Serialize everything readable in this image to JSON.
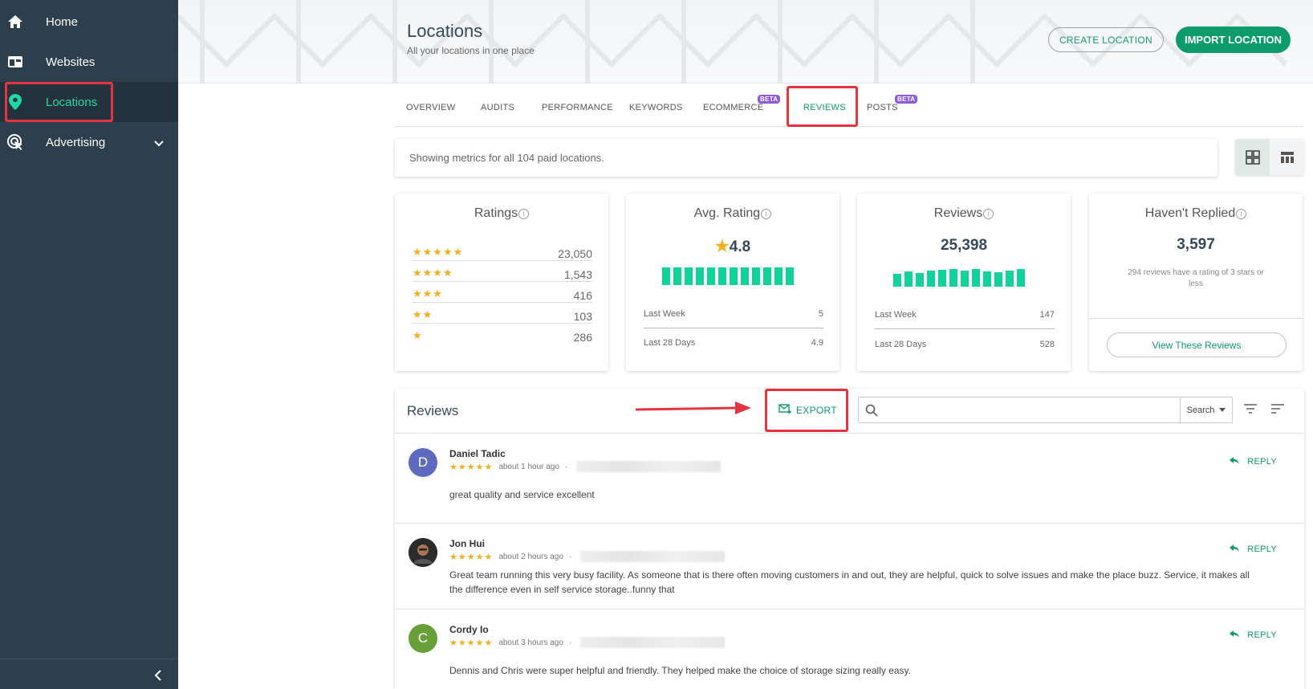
{
  "sidebar": {
    "items": [
      {
        "label": "Home",
        "icon": "home-icon"
      },
      {
        "label": "Websites",
        "icon": "browser-icon"
      },
      {
        "label": "Locations",
        "icon": "map-pin-icon"
      },
      {
        "label": "Advertising",
        "icon": "target-cursor-icon"
      }
    ],
    "active": "Locations"
  },
  "header": {
    "title": "Locations",
    "subtitle": "All your locations in one place",
    "create_label": "CREATE LOCATION",
    "import_label": "IMPORT LOCATION"
  },
  "tabs": [
    {
      "label": "OVERVIEW"
    },
    {
      "label": "AUDITS"
    },
    {
      "label": "PERFORMANCE"
    },
    {
      "label": "KEYWORDS"
    },
    {
      "label": "ECOMMERCE",
      "badge": "BETA"
    },
    {
      "label": "REVIEWS",
      "active": true
    },
    {
      "label": "POSTS",
      "badge": "BETA"
    }
  ],
  "metrics": {
    "text": "Showing metrics for all 104 paid locations."
  },
  "cards": {
    "ratings": {
      "title": "Ratings",
      "rows": [
        {
          "stars": "★★★★★",
          "count": "23,050"
        },
        {
          "stars": "★★★★",
          "count": "1,543"
        },
        {
          "stars": "★★★",
          "count": "416"
        },
        {
          "stars": "★★",
          "count": "103"
        },
        {
          "stars": "★",
          "count": "286"
        }
      ]
    },
    "avg_rating": {
      "title": "Avg. Rating",
      "value": "4.8",
      "star": "★",
      "last_week_label": "Last Week",
      "last_week_value": "5",
      "last_28_label": "Last 28 Days",
      "last_28_value": "4.9"
    },
    "reviews": {
      "title": "Reviews",
      "value": "25,398",
      "last_week_label": "Last Week",
      "last_week_value": "147",
      "last_28_label": "Last 28 Days",
      "last_28_value": "528"
    },
    "not_replied": {
      "title": "Haven't Replied",
      "value": "3,597",
      "note": "294 reviews have a rating of 3 stars or less",
      "button_label": "View These Reviews"
    }
  },
  "reviews_panel": {
    "title": "Reviews",
    "export_label": "EXPORT",
    "search_placeholder": "",
    "search_select": "Search",
    "reply_label": "REPLY",
    "items": [
      {
        "initial": "D",
        "avatar_color": "#5c6bc0",
        "name": "Daniel Tadic",
        "stars": "★★★★★",
        "time": "about 1 hour ago",
        "text": "great quality and service excellent"
      },
      {
        "initial": "",
        "avatar_color": "#3a3a3a",
        "name": "Jon Hui",
        "stars": "★★★★★",
        "time": "about 2 hours ago",
        "text": "Great team running this very busy facility. As someone that is there often moving customers in and out, they are helpful, quick to solve issues and make the place buzz. Service, it makes all the difference even in self service storage..funny that"
      },
      {
        "initial": "C",
        "avatar_color": "#689f38",
        "name": "Cordy Io",
        "stars": "★★★★★",
        "time": "about 3 hours ago",
        "text": "Dennis and Chris were super helpful and friendly. They helped make the choice of storage sizing really easy."
      }
    ]
  },
  "colors": {
    "sidebar_bg": "#2d3e4c",
    "accent": "#0c9b6a",
    "highlight": "#e3343f",
    "star": "#f2b01e"
  }
}
